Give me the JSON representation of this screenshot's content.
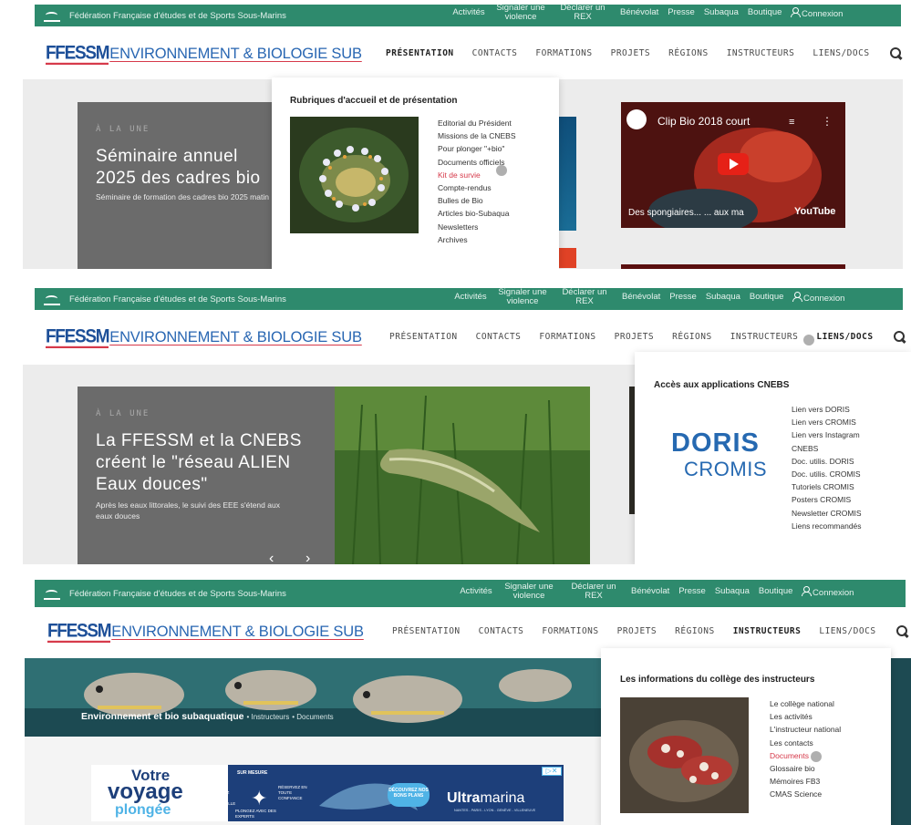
{
  "topbar": {
    "federation": "Fédération Française d'études et de Sports Sous-Marins",
    "links": [
      "Activités",
      "Signaler une violence",
      "Déclarer un REX",
      "Bénévolat",
      "Presse",
      "Subaqua",
      "Boutique"
    ],
    "connexion": "Connexion"
  },
  "brand": {
    "logo": "FFESSM",
    "section": "ENVIRONNEMENT & BIOLOGIE SUB"
  },
  "nav": [
    "PRÉSENTATION",
    "CONTACTS",
    "FORMATIONS",
    "PROJETS",
    "RÉGIONS",
    "INSTRUCTEURS",
    "LIENS/DOCS"
  ],
  "shot1": {
    "active_nav": "PRÉSENTATION",
    "card": {
      "kicker": "À LA UNE",
      "title": "Séminaire annuel 2025 des cadres bio",
      "subtitle": "Séminaire de formation des cadres bio 2025 matin"
    },
    "dropdown": {
      "title": "Rubriques d'accueil et de présentation",
      "items": [
        "Editorial du Président",
        "Missions de la CNEBS",
        "Pour plonger \"+bio\"",
        "Documents officiels",
        "Kit de survie",
        "Compte-rendus",
        "Bulles de Bio",
        "Articles bio-Subaqua",
        "Newsletters",
        "Archives"
      ],
      "highlighted": "Kit de survie"
    },
    "video": {
      "title": "Clip Bio 2018 court",
      "caption": "Des spongiaires... ... aux ma",
      "brand": "YouTube"
    }
  },
  "shot2": {
    "active_nav": "LIENS/DOCS",
    "card": {
      "kicker": "À LA UNE",
      "title": "La FFESSM et la CNEBS créent le \"réseau ALIEN Eaux douces\"",
      "subtitle": "Après les eaux littorales, le suivi des EEE s'étend aux eaux douces"
    },
    "dropdown": {
      "title": "Accès aux applications CNEBS",
      "logo_top": "DORIS",
      "logo_bottom": "CROMIS",
      "items": [
        "Lien vers DORIS",
        "Lien vers CROMIS",
        "Lien vers Instagram CNEBS",
        "Doc. utilis. DORIS",
        "Doc. utilis. CROMIS",
        "Tutoriels CROMIS",
        "Posters CROMIS",
        "Newsletter CROMIS",
        "Liens recommandés"
      ]
    }
  },
  "shot3": {
    "active_nav": "INSTRUCTEURS",
    "breadcrumb": {
      "home": "Environnement et bio subaquatique",
      "level1": "Instructeurs",
      "level2": "Documents"
    },
    "dropdown": {
      "title": "Les informations du collège des instructeurs",
      "items": [
        "Le collège national",
        "Les activités",
        "L'instructeur national",
        "Les contacts",
        "Documents",
        "Glossaire bio",
        "Mémoires FB3",
        "CMAS Science"
      ],
      "highlighted": "Documents"
    },
    "ad": {
      "headline1": "Votre",
      "headline2": "voyage",
      "headline3": "plongée",
      "badge1": "SUR MESURE",
      "tag1": "VOYAGEZ L'ESPRIT TRANQUILLE",
      "tag2": "RÉSERVEZ EN TOUTE CONFIANCE",
      "tag3": "PLONGEZ AVEC DES EXPERTS",
      "cta": "DÉCOUVREZ NOS BONS PLANS",
      "brand_bold": "Ultra",
      "brand_light": "marina",
      "cities": "NANTES - PARIS - LYON - GENÈVE - VILLENEUVE"
    }
  },
  "colors": {
    "green": "#2e8a6d",
    "red": "#d6394a",
    "blue": "#1d4f98",
    "grey": "#6b6b6b"
  }
}
